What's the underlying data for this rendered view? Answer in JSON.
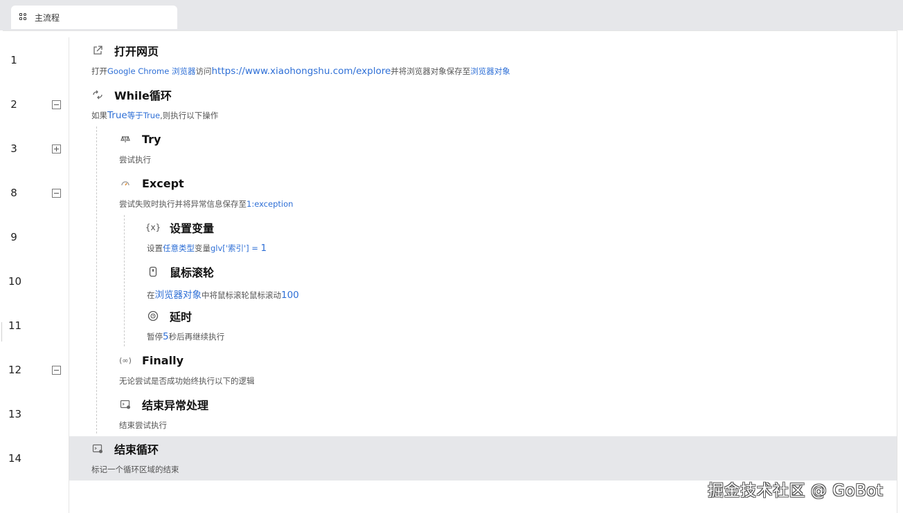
{
  "tab": {
    "label": "主流程",
    "icon": "flow-grid-icon"
  },
  "lines": [
    {
      "no": "1"
    },
    {
      "no": "2"
    },
    {
      "no": "3"
    },
    {
      "no": "8"
    },
    {
      "no": "9"
    },
    {
      "no": "10"
    },
    {
      "no": "11"
    },
    {
      "no": "12"
    },
    {
      "no": "13"
    },
    {
      "no": "14"
    }
  ],
  "steps": {
    "open_page": {
      "icon": "external-link-icon",
      "title": "打开网页",
      "desc": {
        "p1": "打开",
        "browser": "Google Chrome 浏览器",
        "p2": "访问",
        "url": "https://www.xiaohongshu.com/explore",
        "p3": "并将浏览器对象保存至",
        "var": "浏览器对象"
      }
    },
    "while_loop": {
      "icon": "loop-icon",
      "title": "While循环",
      "desc": {
        "p1": "如果",
        "a": "True",
        "op": "等于",
        "b": "True",
        "p2": ",则执行以下操作"
      }
    },
    "try": {
      "icon": "try-icon",
      "title": "Try",
      "desc": "尝试执行"
    },
    "except": {
      "icon": "except-icon",
      "title": "Except",
      "desc": {
        "p1": "尝试失败时执行并将异常信息保存至",
        "var": "1:exception"
      }
    },
    "set_var": {
      "icon": "variable-icon",
      "title": "设置变量",
      "desc": {
        "p1": "设置",
        "type": "任意类型",
        "p2": "变量",
        "expr": "glv['索引'] = ",
        "val": "1"
      }
    },
    "mouse_wheel": {
      "icon": "mouse-icon",
      "title": "鼠标滚轮",
      "desc": {
        "p1": "在",
        "target": "浏览器对象",
        "p2": "中将鼠标滚轮鼠标滚动",
        "amount": "100"
      }
    },
    "delay": {
      "icon": "clock-icon",
      "title": "延时",
      "desc": {
        "p1": "暂停",
        "sec": "5",
        "p2": "秒后再继续执行"
      }
    },
    "finally": {
      "icon": "infinity-icon",
      "title": "Finally",
      "desc": "无论尝试是否成功始终执行以下的逻辑"
    },
    "end_except": {
      "icon": "end-block-icon",
      "title": "结束异常处理",
      "desc": "结束尝试执行"
    },
    "end_loop": {
      "icon": "end-block-icon",
      "title": "结束循环",
      "desc": "标记一个循环区域的结束"
    }
  },
  "watermark": "掘金技术社区 @ GoBot"
}
